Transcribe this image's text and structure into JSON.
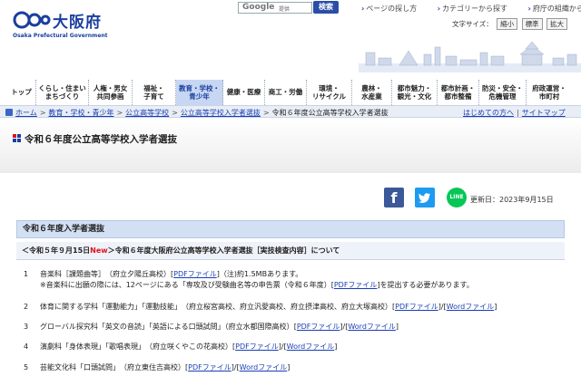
{
  "header": {
    "logo_name": "大阪府",
    "logo_en": "Osaka Prefectural Government",
    "search_engine": "Google",
    "search_sub": "提供",
    "search_button": "検索",
    "top_links": [
      "ページの探し方",
      "カテゴリーから探す",
      "府庁の組織から探す"
    ],
    "text_size_label": "文字サイズ：",
    "text_size_options": [
      "縮小",
      "標準",
      "拡大"
    ]
  },
  "nav": {
    "items": [
      {
        "label": "トップ"
      },
      {
        "label": "くらし・住まい\nまちづくり"
      },
      {
        "label": "人権・男女\n共同参画"
      },
      {
        "label": "福祉・\n子育て"
      },
      {
        "label": "教育・学校・\n青少年",
        "active": true
      },
      {
        "label": "健康・医療"
      },
      {
        "label": "商工・労働"
      },
      {
        "label": "環境・\nリサイクル"
      },
      {
        "label": "農林・\n水産業"
      },
      {
        "label": "都市魅力・\n観光・文化"
      },
      {
        "label": "都市計画・\n都市整備"
      },
      {
        "label": "防災・安全・\n危機管理"
      },
      {
        "label": "府政運営・\n市町村"
      }
    ]
  },
  "breadcrumb": {
    "items": [
      "ホーム",
      "教育・学校・青少年",
      "公立高等学校",
      "公立高等学校入学者選抜"
    ],
    "current": "令和６年度公立高等学校入学者選抜",
    "right_links": [
      "はじめての方へ",
      "サイトマップ"
    ]
  },
  "page": {
    "title": "令和６年度公立高等学校入学者選抜",
    "updated": "更新日：2023年9月15日"
  },
  "social": {
    "facebook": "f",
    "line": "LINE"
  },
  "content": {
    "section_title": "令和６年度入学者選抜",
    "sub_prefix": "＜令和５年９月15日",
    "sub_new": "New",
    "sub_rest": "＞令和６年度大阪府公立高等学校入学者選抜［実技検査内容］について",
    "items": [
      {
        "num": "1",
        "text": "音楽科［課題曲等］　（府立夕陽丘高校）",
        "pdf": "PDFファイル",
        "after": "（注)約1.5MBあります。",
        "note_prefix": "※音楽科に出願の際には、12ページにある「専攻及び受験曲名等の申告票（令和６年度）",
        "note_link": "PDFファイル",
        "note_suffix": "を提出する必要があります。"
      },
      {
        "num": "2",
        "text": "体育に関する学科「運動能力」「運動技能」　（府立桜宮高校、府立汎愛高校、府立摂津高校、府立大塚高校）",
        "pdf": "PDFファイル",
        "word": "Wordファイル"
      },
      {
        "num": "3",
        "text": "グローバル探究科「英文の音読」「英語による口頭試問」（府立水都国際高校）",
        "pdf": "PDFファイル",
        "word": "Wordファイル"
      },
      {
        "num": "4",
        "text": "演劇科「身体表現」「歌唱表現」　（府立咲くやこの花高校）",
        "pdf": "PDFファイル",
        "word": "Wordファイル"
      },
      {
        "num": "5",
        "text": "芸能文化科「口頭試問」　（府立東住吉高校）",
        "pdf": "PDFファイル",
        "word": "Wordファイル"
      }
    ]
  },
  "colors": {
    "brand": "#1a3f9e",
    "nav_active": "#c7d6f2",
    "new": "#e0101a",
    "link": "#1a3fb5"
  }
}
